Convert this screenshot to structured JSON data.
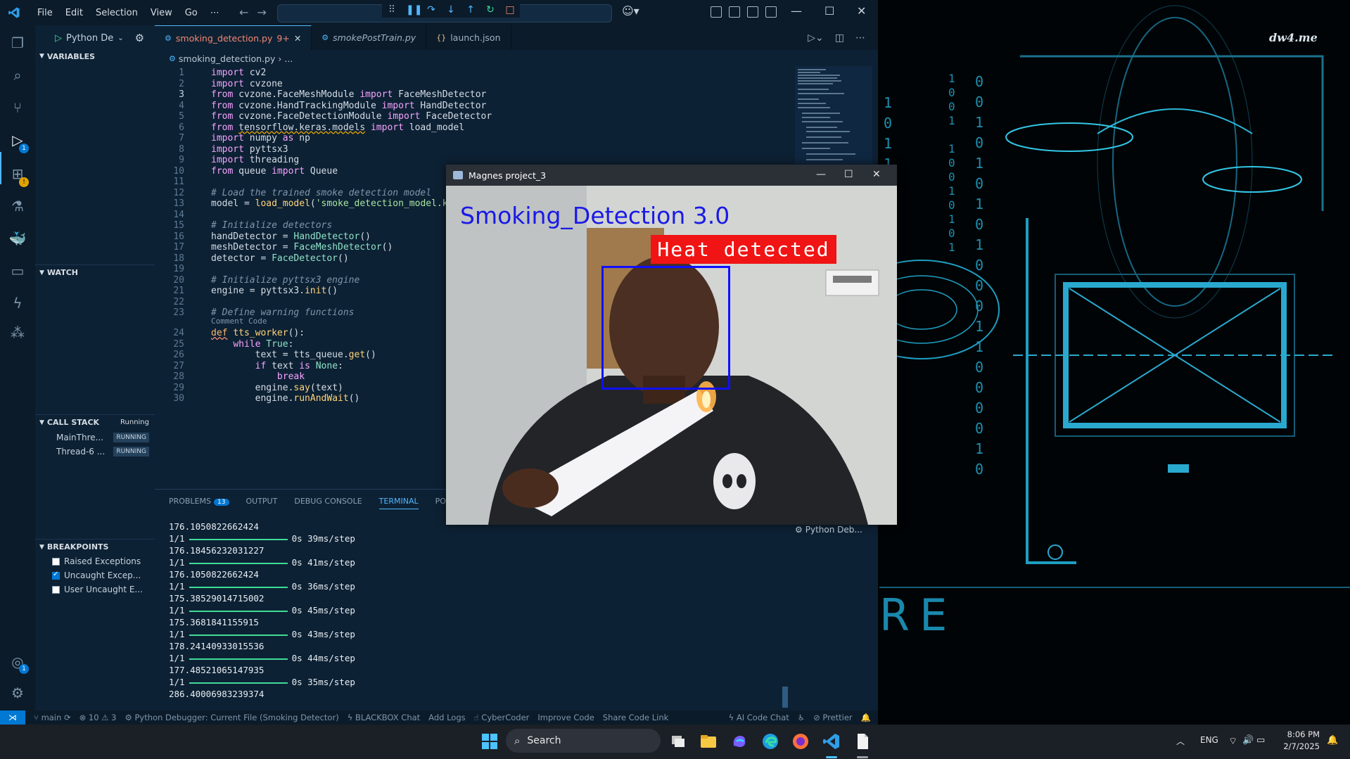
{
  "wallpaper": {
    "brand": "dw4.me",
    "binary_left": "1\n0\n1\n1\n0\n1\n0\n0\n1",
    "binary_mid": "1\n0\n0\n1\n\n1\n0\n0\n1\n0\n1\n0\n1",
    "binary_right": "0\n0\n1\n0\n1\n0\n1\n0\n1\n0\n0\n0\n1\n1\n0\n0\n0\n0\n1\n0",
    "wp_text": "RE"
  },
  "vscode": {
    "menu": [
      "File",
      "Edit",
      "Selection",
      "View",
      "Go",
      "⋯"
    ],
    "run_config": "Python De",
    "tabs": [
      {
        "label": "smoking_detection.py",
        "modified": "9+",
        "active": true
      },
      {
        "label": "smokePostTrain.py",
        "modified": "",
        "active": false
      },
      {
        "label": "launch.json",
        "modified": "",
        "active": false
      }
    ],
    "breadcrumb": {
      "file": "smoking_detection.py",
      "rest": "..."
    },
    "sections": {
      "variables": "VARIABLES",
      "watch": "WATCH",
      "call_stack": "CALL STACK",
      "call_stack_status": "Running",
      "breakpoints": "BREAKPOINTS"
    },
    "threads": [
      {
        "name": "MainThre...",
        "status": "RUNNING"
      },
      {
        "name": "Thread-6 ...",
        "status": "RUNNING"
      }
    ],
    "breakpoints": [
      {
        "label": "Raised Exceptions",
        "checked": false
      },
      {
        "label": "Uncaught Excep...",
        "checked": true
      },
      {
        "label": "User Uncaught E...",
        "checked": false
      }
    ],
    "line_numbers": [
      "1",
      "2",
      "3",
      "4",
      "5",
      "6",
      "7",
      "8",
      "9",
      "10",
      "11",
      "12",
      "13",
      "14",
      "15",
      "16",
      "17",
      "18",
      "19",
      "20",
      "21",
      "22",
      "23",
      "24",
      "25",
      "26",
      "27",
      "28",
      "29",
      "30"
    ],
    "codelens": "Comment Code",
    "panel_tabs": {
      "problems": "PROBLEMS",
      "problems_count": "13",
      "output": "OUTPUT",
      "debug_console": "DEBUG CONSOLE",
      "terminal": "TERMINAL",
      "ports": "PORTS"
    },
    "terminal_lines": [
      {
        "kind": "value",
        "text": "176.1050822662424"
      },
      {
        "kind": "step",
        "prefix": "1/1",
        "suffix": "0s 39ms/step"
      },
      {
        "kind": "value",
        "text": "176.18456232031227"
      },
      {
        "kind": "step",
        "prefix": "1/1",
        "suffix": "0s 41ms/step"
      },
      {
        "kind": "value",
        "text": "176.1050822662424"
      },
      {
        "kind": "step",
        "prefix": "1/1",
        "suffix": "0s 36ms/step"
      },
      {
        "kind": "value",
        "text": "175.38529014715002"
      },
      {
        "kind": "step",
        "prefix": "1/1",
        "suffix": "0s 45ms/step"
      },
      {
        "kind": "value",
        "text": "175.3681841155915"
      },
      {
        "kind": "step",
        "prefix": "1/1",
        "suffix": "0s 43ms/step"
      },
      {
        "kind": "value",
        "text": "178.24140933015536"
      },
      {
        "kind": "step",
        "prefix": "1/1",
        "suffix": "0s 44ms/step"
      },
      {
        "kind": "value",
        "text": "177.48521065147935"
      },
      {
        "kind": "step",
        "prefix": "1/1",
        "suffix": "0s 35ms/step"
      },
      {
        "kind": "value",
        "text": "286.40006983239374"
      }
    ],
    "python_debug_tab": "Python Deb...",
    "statusbar": {
      "branch": "main",
      "errors": "10",
      "warnings": "3",
      "debugger": "Python Debugger: Current File (Smoking Detector)",
      "blackbox": "BLACKBOX Chat",
      "add_logs": "Add Logs",
      "cybercoder": "CyberCoder",
      "improve_code": "Improve Code",
      "share_code_link": "Share Code Link",
      "ai_code_chat": "AI Code Chat",
      "prettier": "Prettier"
    }
  },
  "camera_window": {
    "title": "Magnes project_3",
    "overlay_title": "Smoking_Detection 3.0",
    "heat_label": "Heat detected"
  },
  "taskbar": {
    "search_placeholder": "Search",
    "lang": "ENG",
    "time": "8:06 PM",
    "date": "2/7/2025"
  },
  "colors": {
    "editor_bg": "#0d2134",
    "accent": "#4fb8ff",
    "heat_label_bg": "#f01414",
    "face_box": "#1010ff",
    "overlay_title": "#1a1ae6"
  }
}
